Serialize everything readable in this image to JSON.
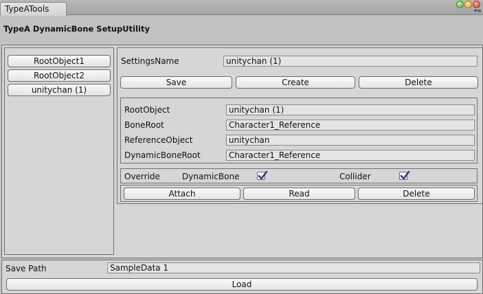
{
  "window": {
    "tab_title": "TypeATools",
    "utility_title": "TypeA DynamicBone SetupUtility"
  },
  "list": {
    "items": [
      "RootObject1",
      "RootObject2",
      "unitychan (1)"
    ]
  },
  "settings": {
    "name_label": "SettingsName",
    "name_value": "unitychan (1)",
    "save_label": "Save",
    "create_label": "Create",
    "delete_label": "Delete"
  },
  "objects": {
    "root_object_label": "RootObject",
    "root_object_value": "unitychan (1)",
    "bone_root_label": "BoneRoot",
    "bone_root_value": "Character1_Reference",
    "reference_object_label": "ReferenceObject",
    "reference_object_value": "unitychan",
    "dynamic_bone_root_label": "DynamicBoneRoot",
    "dynamic_bone_root_value": "Character1_Reference"
  },
  "override": {
    "label": "Override",
    "dynamic_bone_label": "DynamicBone",
    "dynamic_bone_checked": true,
    "collider_label": "Collider",
    "collider_checked": true
  },
  "actions": {
    "attach_label": "Attach",
    "read_label": "Read",
    "delete_label": "Delete"
  },
  "bottom": {
    "save_path_label": "Save Path",
    "save_path_value": "SampleData 1",
    "load_label": "Load"
  },
  "colors": {
    "window_bg": "#c2c2c2",
    "panel_bg": "#d6d6d6",
    "check_color": "#1f3f78"
  }
}
